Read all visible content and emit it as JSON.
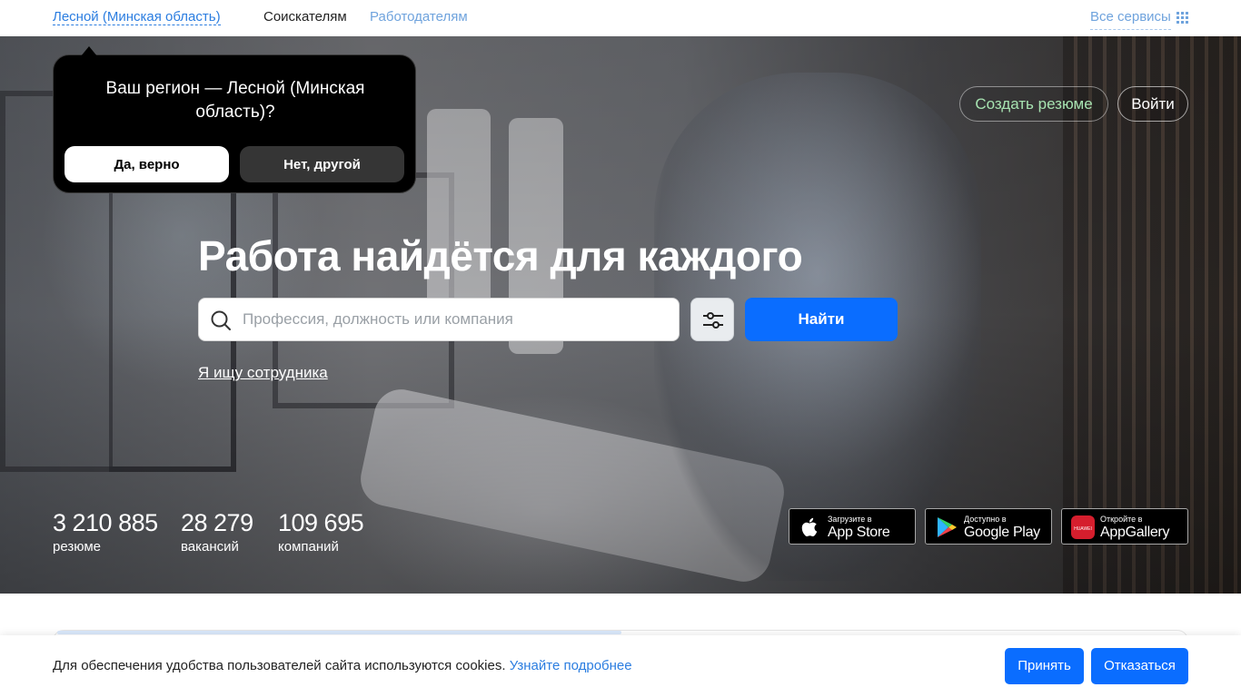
{
  "topbar": {
    "region_link": "Лесной (Минская область)",
    "nav_jobseekers": "Соискателям",
    "nav_employers": "Работодателям",
    "all_services": "Все сервисы",
    "all_services_icon": "grid-icon"
  },
  "region_popup": {
    "question": "Ваш регион — Лесной (Минская область)?",
    "yes_label": "Да, верно",
    "no_label": "Нет, другой"
  },
  "hero": {
    "create_resume": "Создать резюме",
    "login": "Войти",
    "headline": "Работа найдётся для каждого",
    "search_placeholder": "Профессия, должность или компания",
    "search_value": "",
    "search_icon": "search-icon",
    "filter_icon": "sliders-icon",
    "find_label": "Найти",
    "employer_link": "Я ищу сотрудника"
  },
  "stats": [
    {
      "value": "3 210 885",
      "label": "резюме"
    },
    {
      "value": "28 279",
      "label": "вакансий"
    },
    {
      "value": "109 695",
      "label": "компаний"
    }
  ],
  "stores": [
    {
      "small": "Загрузите в",
      "big": "App Store",
      "icon": "apple-icon"
    },
    {
      "small": "Доступно в",
      "big": "Google Play",
      "icon": "google-play-icon"
    },
    {
      "small": "Откройте в",
      "big": "AppGallery",
      "icon": "huawei-icon",
      "icon_text": "HUAWEI"
    }
  ],
  "cookie": {
    "text": "Для обеспечения удобства пользователей сайта используются cookies.",
    "more": "Узнайте подробнее",
    "accept": "Принять",
    "decline": "Отказаться"
  },
  "colors": {
    "accent": "#0a6dff",
    "link": "#2b7de0",
    "resume_green": "#a7e3b1"
  }
}
